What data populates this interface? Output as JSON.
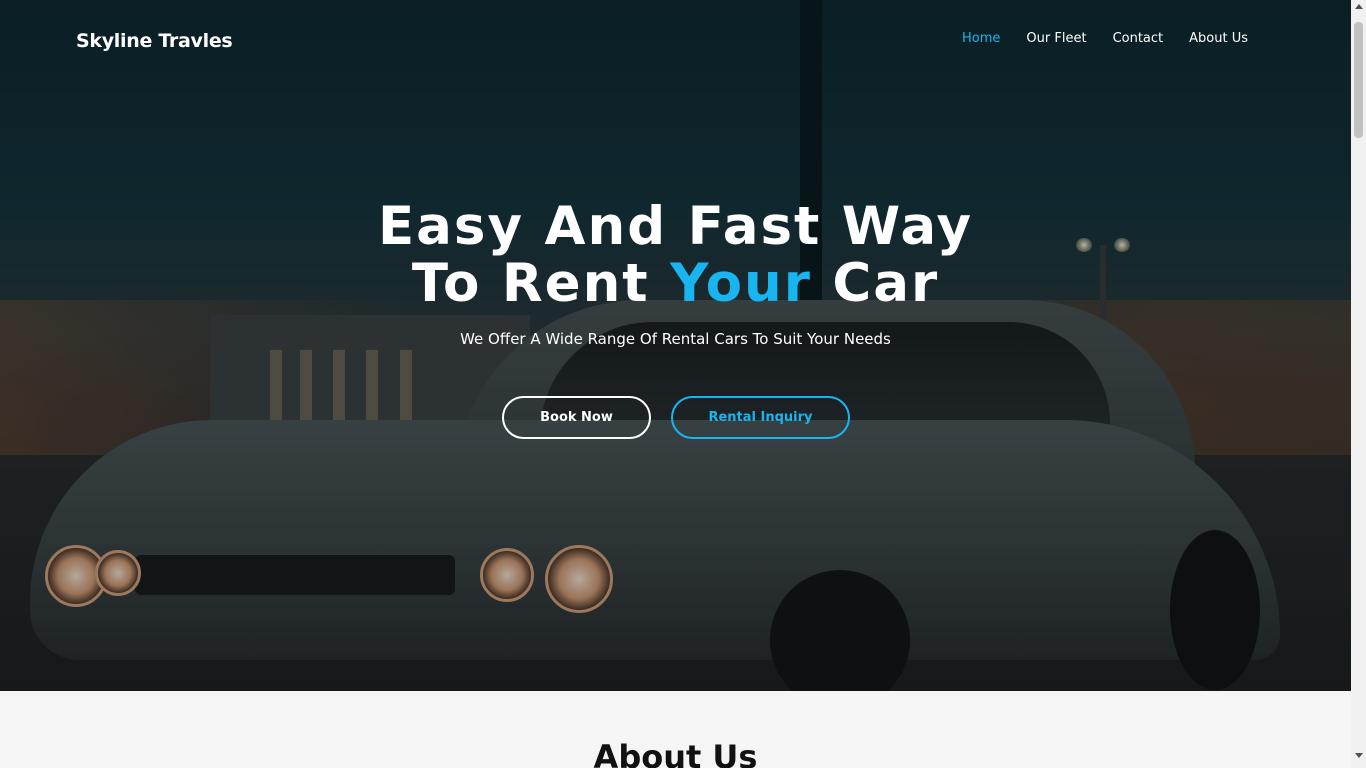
{
  "header": {
    "brand": "Skyline Travles",
    "nav": [
      {
        "label": "Home",
        "active": true
      },
      {
        "label": "Our Fleet",
        "active": false
      },
      {
        "label": "Contact",
        "active": false
      },
      {
        "label": "About Us",
        "active": false
      }
    ]
  },
  "hero": {
    "headline_line1": "Easy And Fast Way",
    "headline_line2_prefix": "To Rent ",
    "headline_line2_accent": "Your",
    "headline_line2_suffix": " Car",
    "subtitle": "We Offer A Wide Range Of Rental Cars To Suit Your Needs",
    "primary_button": "Book Now",
    "secondary_button": "Rental Inquiry"
  },
  "about": {
    "title": "About Us"
  },
  "colors": {
    "accent": "#19b5f0",
    "text_light": "#ffffff",
    "section_bg": "#f5f5f5"
  }
}
